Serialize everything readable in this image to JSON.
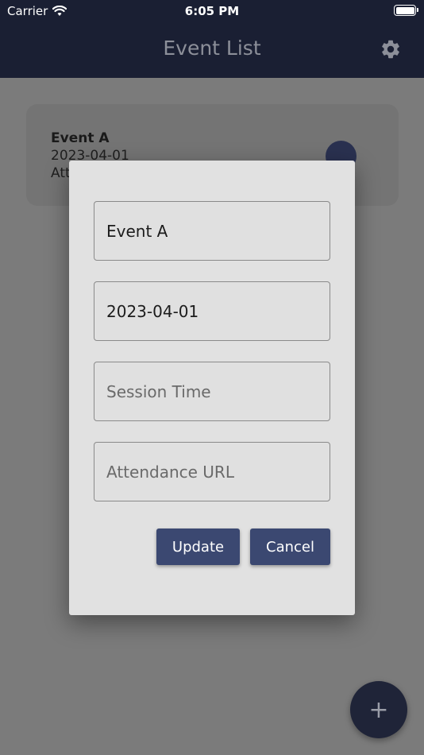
{
  "status_bar": {
    "carrier": "Carrier",
    "time": "6:05 PM"
  },
  "app_bar": {
    "title": "Event List"
  },
  "event_card": {
    "name": "Event A",
    "date": "2023-04-01",
    "attendance_partial": "Att"
  },
  "dialog": {
    "fields": [
      {
        "value": "Event A",
        "placeholder": ""
      },
      {
        "value": "2023-04-01",
        "placeholder": ""
      },
      {
        "value": "",
        "placeholder": "Session Time"
      },
      {
        "value": "",
        "placeholder": "Attendance URL"
      }
    ],
    "update_label": "Update",
    "cancel_label": "Cancel"
  },
  "fab": {
    "icon": "plus-icon",
    "label": "+"
  },
  "colors": {
    "appbar": "#1a1f33",
    "button": "#3b4871",
    "dialog": "#e1e1e1",
    "overlay": "#7b7b7b"
  }
}
